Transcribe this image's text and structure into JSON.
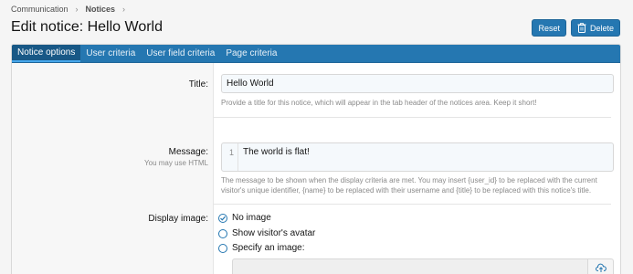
{
  "breadcrumb": {
    "items": [
      "Communication",
      "Notices"
    ]
  },
  "page_title": "Edit notice: Hello World",
  "actions": {
    "reset_label": "Reset",
    "delete_label": "Delete"
  },
  "tabs": [
    {
      "label": "Notice options"
    },
    {
      "label": "User criteria"
    },
    {
      "label": "User field criteria"
    },
    {
      "label": "Page criteria"
    }
  ],
  "form": {
    "title": {
      "label": "Title:",
      "value": "Hello World",
      "hint": "Provide a title for this notice, which will appear in the tab header of the notices area. Keep it short!"
    },
    "message": {
      "label": "Message:",
      "sublabel": "You may use HTML",
      "line_number": "1",
      "value": "The world is flat!",
      "hint_line1": "The message to be shown when the display criteria are met. You may insert {user_id} to be replaced with the current",
      "hint_line2": "visitor's unique identifier, {name} to be replaced with their username and {title} to be replaced with this notice's title."
    },
    "display_image": {
      "label": "Display image:",
      "options": [
        {
          "label": "No image",
          "selected": true
        },
        {
          "label": "Show visitor's avatar",
          "selected": false
        },
        {
          "label": "Specify an image:",
          "selected": false
        }
      ],
      "image_value": ""
    }
  },
  "colors": {
    "accent": "#2577b1",
    "active_tab": "#185886"
  }
}
